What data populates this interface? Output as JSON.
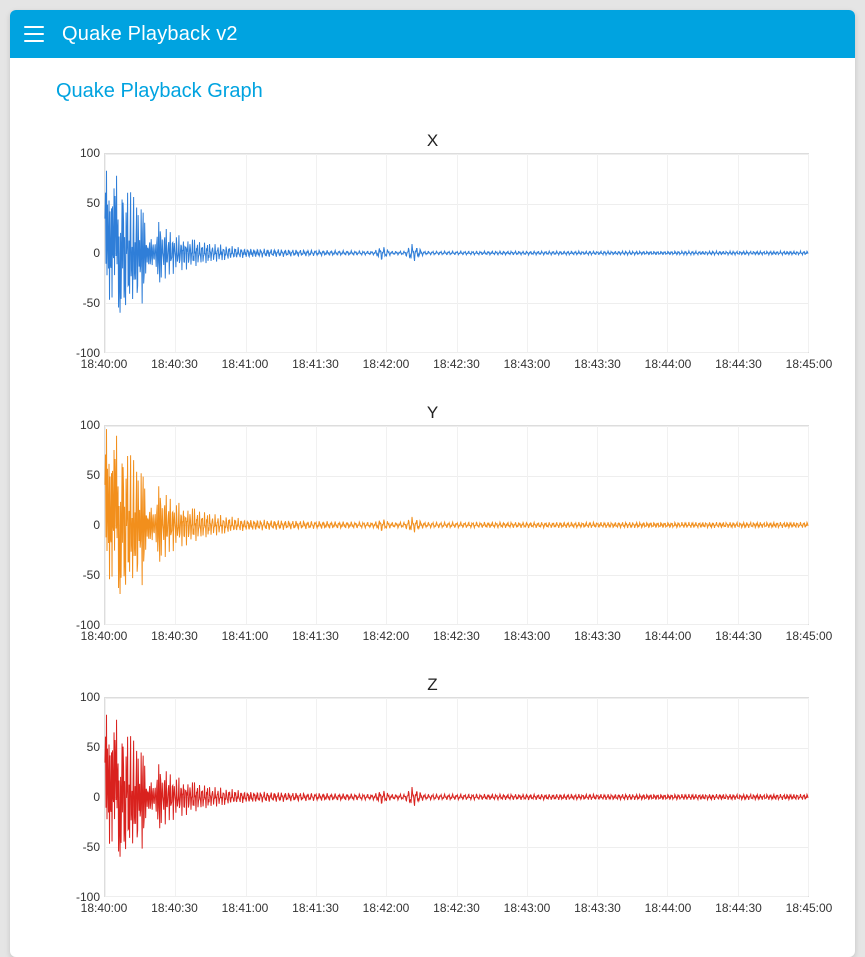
{
  "topbar": {
    "title": "Quake Playback v2",
    "menu_icon": "hamburger-icon"
  },
  "page": {
    "title": "Quake Playback Graph"
  },
  "chart_data": [
    {
      "type": "line",
      "title": "X",
      "color": "#2f7ed8",
      "xlabel": "",
      "ylabel": "",
      "ylim": [
        -100,
        100
      ],
      "y_ticks": [
        -100,
        -50,
        0,
        50,
        100
      ],
      "x_range_seconds": [
        0,
        300
      ],
      "x_tick_labels": [
        "18:40:00",
        "18:40:30",
        "18:41:00",
        "18:41:30",
        "18:42:00",
        "18:42:30",
        "18:43:00",
        "18:43:30",
        "18:44:00",
        "18:44:30",
        "18:45:00"
      ],
      "envelope_points": [
        {
          "t": 0,
          "amp": 90
        },
        {
          "t": 10,
          "amp": 70
        },
        {
          "t": 20,
          "amp": 40
        },
        {
          "t": 30,
          "amp": 20
        },
        {
          "t": 45,
          "amp": 10
        },
        {
          "t": 60,
          "amp": 5
        },
        {
          "t": 90,
          "amp": 3
        },
        {
          "t": 115,
          "amp": 2
        },
        {
          "t": 118,
          "amp": 8
        },
        {
          "t": 122,
          "amp": 2
        },
        {
          "t": 128,
          "amp": 2
        },
        {
          "t": 131,
          "amp": 10
        },
        {
          "t": 136,
          "amp": 2
        },
        {
          "t": 180,
          "amp": 2
        },
        {
          "t": 240,
          "amp": 2
        },
        {
          "t": 300,
          "amp": 2
        }
      ]
    },
    {
      "type": "line",
      "title": "Y",
      "color": "#f28f1c",
      "xlabel": "",
      "ylabel": "",
      "ylim": [
        -100,
        100
      ],
      "y_ticks": [
        -100,
        -50,
        0,
        50,
        100
      ],
      "x_range_seconds": [
        0,
        300
      ],
      "x_tick_labels": [
        "18:40:00",
        "18:40:30",
        "18:41:00",
        "18:41:30",
        "18:42:00",
        "18:42:30",
        "18:43:00",
        "18:43:30",
        "18:44:00",
        "18:44:30",
        "18:45:00"
      ],
      "envelope_points": [
        {
          "t": 0,
          "amp": 105
        },
        {
          "t": 10,
          "amp": 80
        },
        {
          "t": 20,
          "amp": 50
        },
        {
          "t": 30,
          "amp": 25
        },
        {
          "t": 45,
          "amp": 12
        },
        {
          "t": 60,
          "amp": 6
        },
        {
          "t": 90,
          "amp": 4
        },
        {
          "t": 115,
          "amp": 3
        },
        {
          "t": 118,
          "amp": 7
        },
        {
          "t": 122,
          "amp": 3
        },
        {
          "t": 128,
          "amp": 3
        },
        {
          "t": 131,
          "amp": 9
        },
        {
          "t": 136,
          "amp": 3
        },
        {
          "t": 180,
          "amp": 3
        },
        {
          "t": 240,
          "amp": 3
        },
        {
          "t": 300,
          "amp": 3
        }
      ]
    },
    {
      "type": "line",
      "title": "Z",
      "color": "#d9221e",
      "xlabel": "",
      "ylabel": "",
      "ylim": [
        -100,
        100
      ],
      "y_ticks": [
        -100,
        -50,
        0,
        50,
        100
      ],
      "x_range_seconds": [
        0,
        300
      ],
      "x_tick_labels": [
        "18:40:00",
        "18:40:30",
        "18:41:00",
        "18:41:30",
        "18:42:00",
        "18:42:30",
        "18:43:00",
        "18:43:30",
        "18:44:00",
        "18:44:30",
        "18:45:00"
      ],
      "envelope_points": [
        {
          "t": 0,
          "amp": 90
        },
        {
          "t": 10,
          "amp": 70
        },
        {
          "t": 20,
          "amp": 42
        },
        {
          "t": 30,
          "amp": 22
        },
        {
          "t": 45,
          "amp": 11
        },
        {
          "t": 60,
          "amp": 6
        },
        {
          "t": 90,
          "amp": 4
        },
        {
          "t": 115,
          "amp": 3
        },
        {
          "t": 118,
          "amp": 8
        },
        {
          "t": 122,
          "amp": 3
        },
        {
          "t": 128,
          "amp": 3
        },
        {
          "t": 131,
          "amp": 11
        },
        {
          "t": 136,
          "amp": 3
        },
        {
          "t": 180,
          "amp": 3
        },
        {
          "t": 240,
          "amp": 3
        },
        {
          "t": 300,
          "amp": 3
        }
      ]
    }
  ]
}
